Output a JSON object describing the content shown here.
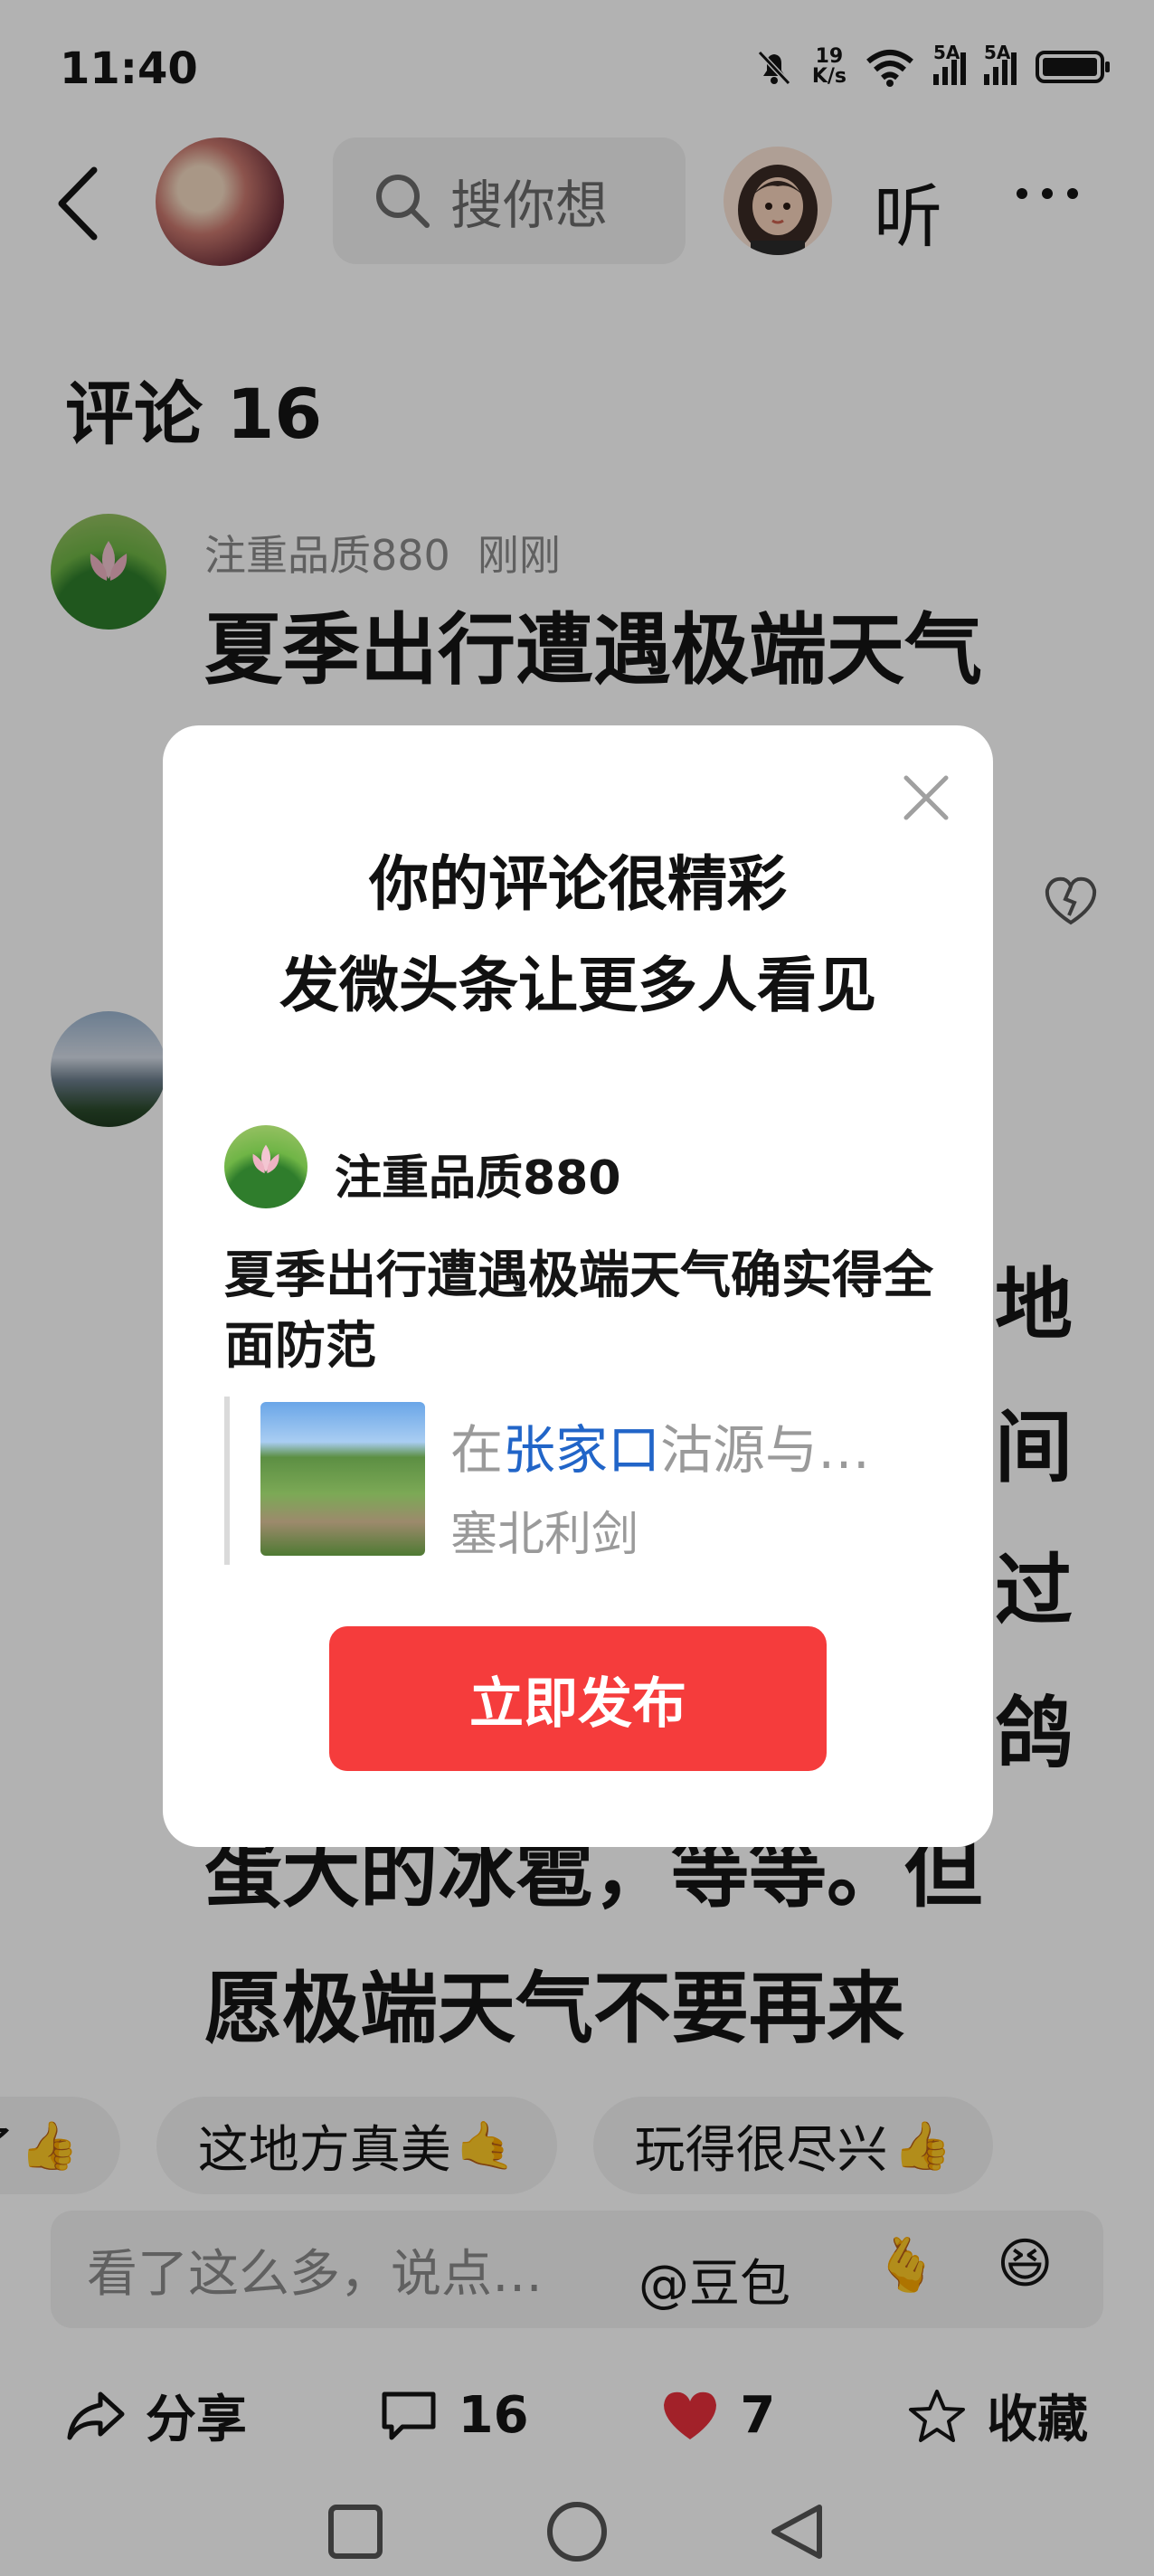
{
  "status_bar": {
    "time": "11:40",
    "net_speed_value": "19",
    "net_speed_unit": "K/s",
    "sim1": "5A",
    "sim2": "5A"
  },
  "header": {
    "search_placeholder": "搜你想",
    "listen_label": "听"
  },
  "comments": {
    "title": "评论 16",
    "first": {
      "user": "注重品质880",
      "time": "刚刚",
      "text": "夏季出行遭遇极端天气"
    },
    "second_partial": {
      "edge_chars": [
        "地",
        "间",
        "过",
        "鸽"
      ],
      "line_a": "蛋大的冰雹，等等。但",
      "line_b": "愿极端天气不要再来"
    }
  },
  "quick_replies": [
    "了",
    "这地方真美",
    "玩得很尽兴"
  ],
  "input": {
    "placeholder": "看了这么多，说点…",
    "doubao": "@豆包"
  },
  "actions": {
    "share": "分享",
    "comments": "16",
    "likes": "7",
    "favorite": "收藏"
  },
  "dialog": {
    "title_line1": "你的评论很精彩",
    "title_line2": "发微头条让更多人看见",
    "user": "注重品质880",
    "text": "夏季出行遭遇极端天气确实得全面防范",
    "quote_prefix": "在",
    "quote_highlight": "张家口",
    "quote_suffix": "沽源与…",
    "quote_source": "塞北利剑",
    "publish_button": "立即发布"
  },
  "colors": {
    "accent_red": "#f53c3c",
    "link_blue": "#2165c8",
    "overlay": "rgba(0,0,0,0.30)"
  }
}
